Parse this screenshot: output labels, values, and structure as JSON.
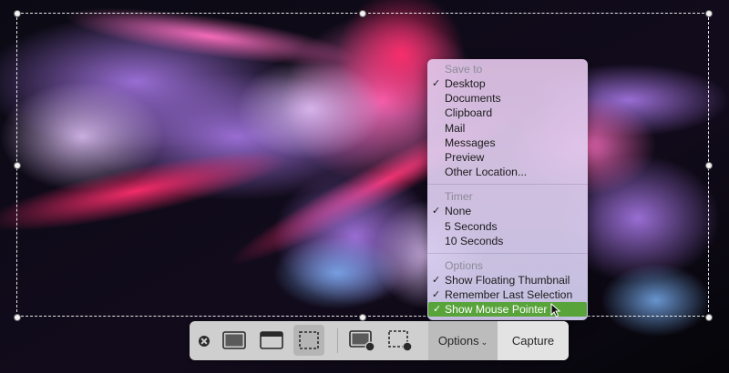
{
  "menu": {
    "save_to": {
      "header": "Save to",
      "items": [
        {
          "label": "Desktop",
          "checked": true
        },
        {
          "label": "Documents",
          "checked": false
        },
        {
          "label": "Clipboard",
          "checked": false
        },
        {
          "label": "Mail",
          "checked": false
        },
        {
          "label": "Messages",
          "checked": false
        },
        {
          "label": "Preview",
          "checked": false
        },
        {
          "label": "Other Location...",
          "checked": false
        }
      ]
    },
    "timer": {
      "header": "Timer",
      "items": [
        {
          "label": "None",
          "checked": true
        },
        {
          "label": "5 Seconds",
          "checked": false
        },
        {
          "label": "10 Seconds",
          "checked": false
        }
      ]
    },
    "options": {
      "header": "Options",
      "items": [
        {
          "label": "Show Floating Thumbnail",
          "checked": true
        },
        {
          "label": "Remember Last Selection",
          "checked": true
        },
        {
          "label": "Show Mouse Pointer",
          "checked": true,
          "highlighted": true
        }
      ]
    },
    "check_glyph": "✓"
  },
  "toolbar": {
    "close_icon": "close-icon",
    "tools": [
      {
        "icon": "capture-entire-screen-icon"
      },
      {
        "icon": "capture-window-icon"
      },
      {
        "icon": "capture-selection-icon",
        "active": true
      },
      {
        "icon": "record-screen-icon"
      },
      {
        "icon": "record-selection-icon"
      }
    ],
    "options_label": "Options",
    "options_chevron": "⌄",
    "capture_label": "Capture"
  },
  "colors": {
    "highlight": "#58a33a",
    "toolbar_bg": "#cfcfcf",
    "menu_header_text": "#8b8b98"
  }
}
